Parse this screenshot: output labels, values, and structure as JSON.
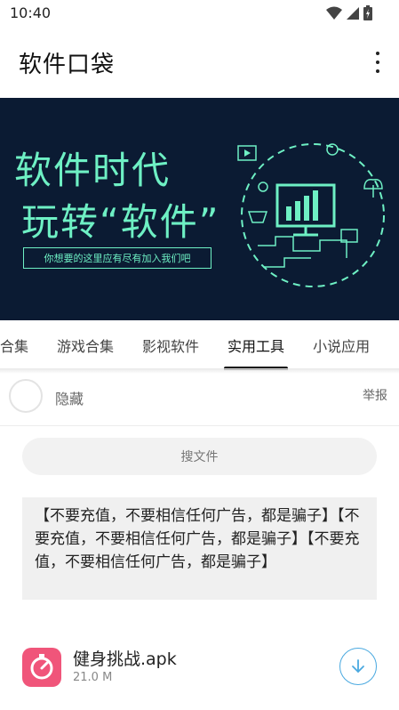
{
  "status_bar": {
    "time": "10:40",
    "icons": [
      "wifi-icon",
      "signal-icon",
      "battery-icon"
    ]
  },
  "app_bar": {
    "title": "软件口袋",
    "overflow_icon": "more-vert-icon"
  },
  "banner": {
    "line1": "软件时代",
    "line2": "玩转“软件”",
    "subtitle": "你想要的这里应有尽有加入我们吧",
    "accent_color": "#6ef0c4",
    "background_color": "#0b1b33"
  },
  "tabs": {
    "items": [
      "合集",
      "游戏合集",
      "影视软件",
      "实用工具",
      "小说应用"
    ],
    "active_index": 3
  },
  "post": {
    "username": "隐藏",
    "report_label": "举报"
  },
  "search": {
    "placeholder": "搜文件"
  },
  "notice": {
    "text": "【不要充值，不要相信任何广告，都是骗子】【不要充值，不要相信任何广告，都是骗子】【不要充值，不要相信任何广告，都是骗子】"
  },
  "file": {
    "name": "健身挑战.apk",
    "size": "21.0 M",
    "icon": "fitness-app-icon",
    "icon_color": "#f0557a",
    "download_icon": "download-icon"
  }
}
